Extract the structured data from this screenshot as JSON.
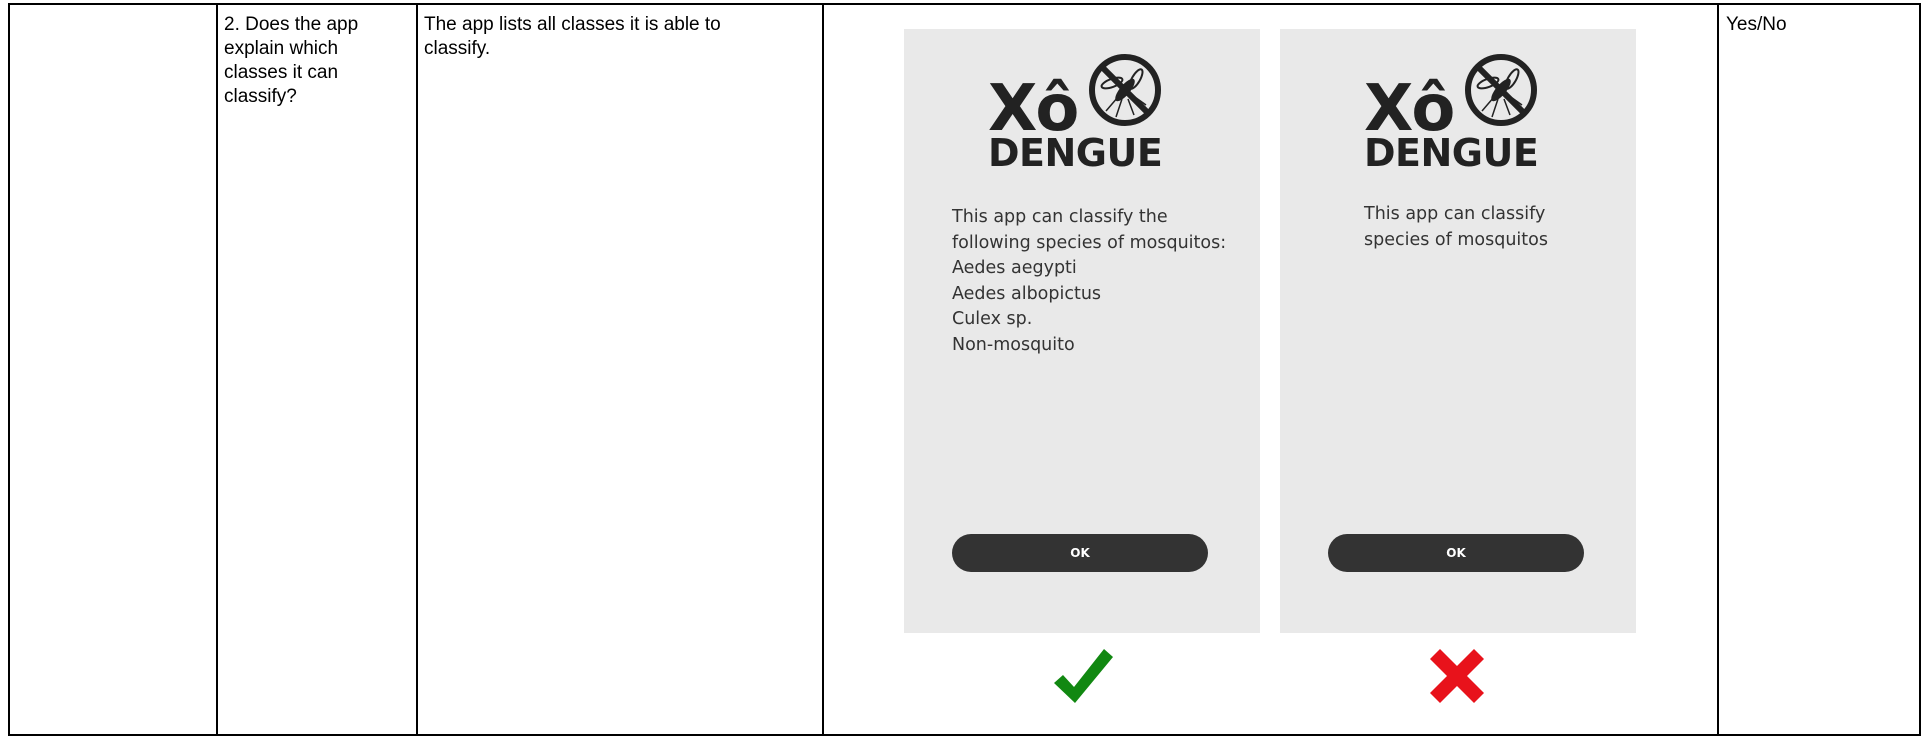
{
  "row": {
    "question": "2. Does the app explain which classes it can classify?",
    "question_lines": [
      "2. Does the app",
      "explain which",
      "classes it can",
      "classify?"
    ],
    "description_lines": [
      "The app lists all classes it is able to",
      "classify."
    ],
    "answer": "Yes/No"
  },
  "examples": [
    {
      "logo_top": "Xô",
      "logo_bottom": "DENGUE",
      "text_lines": [
        "This app can classify the",
        "following species of mosquitos:",
        "Aedes aegypti",
        "Aedes albopictus",
        "Culex sp.",
        "Non-mosquito"
      ],
      "button_label": "OK",
      "verdict": "correct",
      "verdict_icon": "check-icon",
      "verdict_color": "#118811"
    },
    {
      "logo_top": "Xô",
      "logo_bottom": "DENGUE",
      "text_lines": [
        "This app can classify",
        "species of mosquitos"
      ],
      "button_label": "OK",
      "verdict": "incorrect",
      "verdict_icon": "cross-icon",
      "verdict_color": "#e8121b"
    }
  ],
  "colors": {
    "phone_background": "#e9e9e9",
    "button": "#333333",
    "logo": "#222222"
  }
}
